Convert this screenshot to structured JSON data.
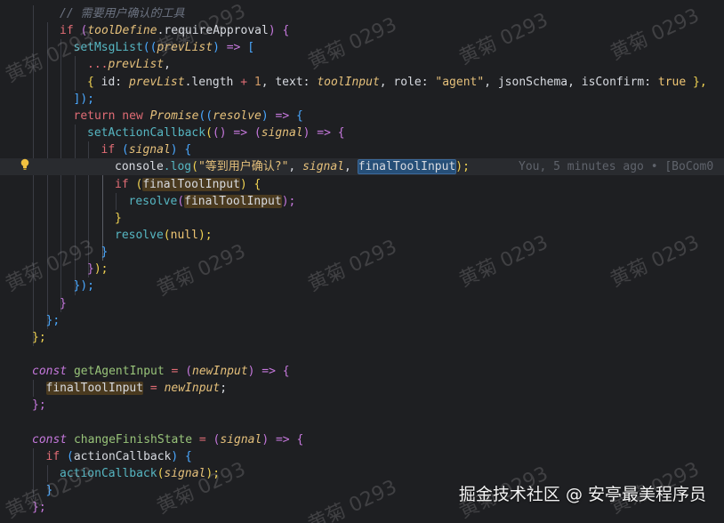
{
  "editor": {
    "blame": "You, 5 minutes ago • [BoCom0",
    "credit": "掘金技术社区 @ 安亭最美程序员",
    "watermark": "黄菊 0293",
    "lines": [
      [
        {
          "t": "// 需要用户确认的工具",
          "c": "c-comment"
        }
      ],
      [
        {
          "t": "if",
          "c": "c-kw-red"
        },
        {
          "t": " (",
          "c": "c-brace2"
        },
        {
          "t": "toolDefine",
          "c": "c-var"
        },
        {
          "t": ".requireApproval",
          "c": "c-plain"
        },
        {
          "t": ")",
          "c": "c-brace2"
        },
        {
          "t": " {",
          "c": "c-brace2"
        }
      ],
      [
        {
          "t": "setMsgList",
          "c": "c-fn"
        },
        {
          "t": "(",
          "c": "c-brace3"
        },
        {
          "t": "(",
          "c": "c-brace3"
        },
        {
          "t": "prevList",
          "c": "c-var"
        },
        {
          "t": ")",
          "c": "c-brace3"
        },
        {
          "t": " => ",
          "c": "c-kw"
        },
        {
          "t": "[",
          "c": "c-brace3"
        }
      ],
      [
        {
          "t": "...",
          "c": "c-op"
        },
        {
          "t": "prevList",
          "c": "c-var"
        },
        {
          "t": ",",
          "c": "c-punc"
        }
      ],
      [
        {
          "t": "{",
          "c": "c-brace1"
        },
        {
          "t": " id: ",
          "c": "c-plain"
        },
        {
          "t": "prevList",
          "c": "c-var"
        },
        {
          "t": ".length ",
          "c": "c-plain"
        },
        {
          "t": "+",
          "c": "c-op"
        },
        {
          "t": " 1",
          "c": "c-num"
        },
        {
          "t": ", text: ",
          "c": "c-plain"
        },
        {
          "t": "toolInput",
          "c": "c-var"
        },
        {
          "t": ", role: ",
          "c": "c-plain"
        },
        {
          "t": "\"agent\"",
          "c": "c-str"
        },
        {
          "t": ", jsonSchema, isConfirm: ",
          "c": "c-plain"
        },
        {
          "t": "true",
          "c": "c-bool"
        },
        {
          "t": " },",
          "c": "c-brace1"
        }
      ],
      [
        {
          "t": "]",
          "c": "c-brace3"
        },
        {
          "t": ");",
          "c": "c-brace3"
        }
      ],
      [
        {
          "t": "return",
          "c": "c-kw-red"
        },
        {
          "t": " new ",
          "c": "c-kw-red"
        },
        {
          "t": "Promise",
          "c": "c-global"
        },
        {
          "t": "(",
          "c": "c-brace3"
        },
        {
          "t": "(",
          "c": "c-brace3"
        },
        {
          "t": "resolve",
          "c": "c-var"
        },
        {
          "t": ")",
          "c": "c-brace3"
        },
        {
          "t": " => ",
          "c": "c-kw"
        },
        {
          "t": "{",
          "c": "c-brace3"
        }
      ],
      [
        {
          "t": "setActionCallback",
          "c": "c-fn"
        },
        {
          "t": "(",
          "c": "c-brace1"
        },
        {
          "t": "()",
          "c": "c-brace2"
        },
        {
          "t": " => ",
          "c": "c-kw"
        },
        {
          "t": "(",
          "c": "c-brace2"
        },
        {
          "t": "signal",
          "c": "c-var"
        },
        {
          "t": ")",
          "c": "c-brace2"
        },
        {
          "t": " => ",
          "c": "c-kw"
        },
        {
          "t": "{",
          "c": "c-brace2"
        }
      ],
      [
        {
          "t": "if",
          "c": "c-kw-red"
        },
        {
          "t": " (",
          "c": "c-brace3"
        },
        {
          "t": "signal",
          "c": "c-var"
        },
        {
          "t": ")",
          "c": "c-brace3"
        },
        {
          "t": " {",
          "c": "c-brace3"
        }
      ],
      [
        {
          "t": "console",
          "c": "c-plain"
        },
        {
          "t": ".log",
          "c": "c-fn"
        },
        {
          "t": "(",
          "c": "c-brace1"
        },
        {
          "t": "\"等到用户确认?\"",
          "c": "c-str"
        },
        {
          "t": ", ",
          "c": "c-plain"
        },
        {
          "t": "signal",
          "c": "c-var"
        },
        {
          "t": ", ",
          "c": "c-plain"
        },
        {
          "t": "finalToolInput",
          "c": "c-plain hl-sel"
        },
        {
          "t": ");",
          "c": "c-brace1"
        }
      ],
      [
        {
          "t": "if",
          "c": "c-kw-red"
        },
        {
          "t": " (",
          "c": "c-brace1"
        },
        {
          "t": "finalToolInput",
          "c": "c-plain hl"
        },
        {
          "t": ")",
          "c": "c-brace1"
        },
        {
          "t": " {",
          "c": "c-brace1"
        }
      ],
      [
        {
          "t": "resolve",
          "c": "c-fn"
        },
        {
          "t": "(",
          "c": "c-brace2"
        },
        {
          "t": "finalToolInput",
          "c": "c-plain hl"
        },
        {
          "t": ");",
          "c": "c-brace2"
        }
      ],
      [
        {
          "t": "}",
          "c": "c-brace1"
        }
      ],
      [
        {
          "t": "resolve",
          "c": "c-fn"
        },
        {
          "t": "(",
          "c": "c-brace1"
        },
        {
          "t": "null",
          "c": "c-bool"
        },
        {
          "t": ");",
          "c": "c-brace1"
        }
      ],
      [
        {
          "t": "}",
          "c": "c-brace3"
        }
      ],
      [
        {
          "t": "}",
          "c": "c-brace2"
        },
        {
          "t": ");",
          "c": "c-brace1"
        }
      ],
      [
        {
          "t": "}",
          "c": "c-brace3"
        },
        {
          "t": ");",
          "c": "c-brace3"
        }
      ],
      [
        {
          "t": "}",
          "c": "c-brace2"
        }
      ],
      [
        {
          "t": "};",
          "c": "c-brace3"
        }
      ],
      [
        {
          "t": "};",
          "c": "c-brace1"
        }
      ],
      [],
      [
        {
          "t": "const",
          "c": "c-const"
        },
        {
          "t": " getAgentInput ",
          "c": "c-fnname"
        },
        {
          "t": "=",
          "c": "c-op"
        },
        {
          "t": " (",
          "c": "c-brace2"
        },
        {
          "t": "newInput",
          "c": "c-var"
        },
        {
          "t": ")",
          "c": "c-brace2"
        },
        {
          "t": " => ",
          "c": "c-kw"
        },
        {
          "t": "{",
          "c": "c-brace2"
        }
      ],
      [
        {
          "t": "finalToolInput",
          "c": "c-plain hl"
        },
        {
          "t": " = ",
          "c": "c-op"
        },
        {
          "t": "newInput",
          "c": "c-var"
        },
        {
          "t": ";",
          "c": "c-punc"
        }
      ],
      [
        {
          "t": "};",
          "c": "c-brace2"
        }
      ],
      [],
      [
        {
          "t": "const",
          "c": "c-const"
        },
        {
          "t": " changeFinishState ",
          "c": "c-fnname"
        },
        {
          "t": "=",
          "c": "c-op"
        },
        {
          "t": " (",
          "c": "c-brace2"
        },
        {
          "t": "signal",
          "c": "c-var"
        },
        {
          "t": ")",
          "c": "c-brace2"
        },
        {
          "t": " => ",
          "c": "c-kw"
        },
        {
          "t": "{",
          "c": "c-brace2"
        }
      ],
      [
        {
          "t": "if",
          "c": "c-kw-red"
        },
        {
          "t": " (",
          "c": "c-brace3"
        },
        {
          "t": "actionCallback",
          "c": "c-plain"
        },
        {
          "t": ")",
          "c": "c-brace3"
        },
        {
          "t": " {",
          "c": "c-brace3"
        }
      ],
      [
        {
          "t": "actionCallback",
          "c": "c-fn"
        },
        {
          "t": "(",
          "c": "c-brace1"
        },
        {
          "t": "signal",
          "c": "c-var"
        },
        {
          "t": ");",
          "c": "c-brace1"
        }
      ],
      [
        {
          "t": "}",
          "c": "c-brace3"
        }
      ],
      [
        {
          "t": "};",
          "c": "c-brace2"
        }
      ]
    ]
  }
}
